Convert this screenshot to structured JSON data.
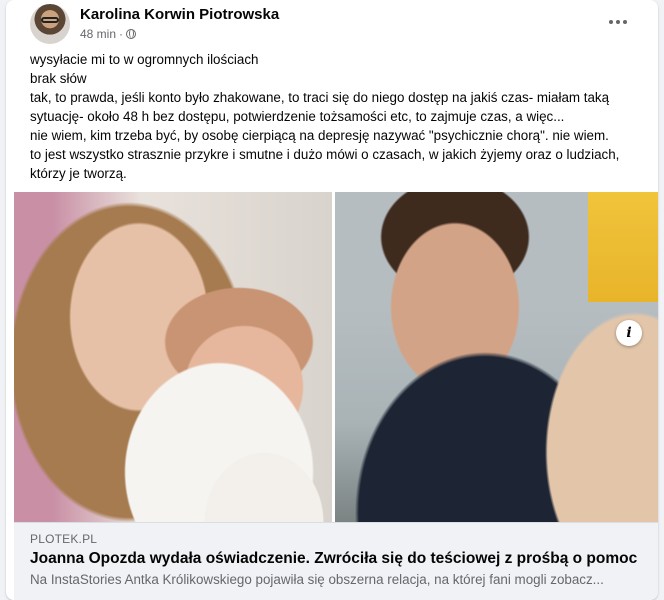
{
  "post": {
    "author": "Karolina Korwin Piotrowska",
    "time": "48 min",
    "separator": "·",
    "lines": [
      "wysyłacie mi to w ogromnych ilościach",
      "brak słów",
      "tak, to prawda, jeśli konto było zhakowane, to traci się do niego dostęp na jakiś czas- miałam taką sytuację- około 48 h bez dostępu, potwierdzenie tożsamości etc, to zajmuje czas, a więc...",
      "nie wiem, kim trzeba być, by osobę cierpiącą na depresję nazywać \"psychicznie chorą\". nie wiem.",
      "to jest wszystko strasznie przykre i smutne i dużo mówi o czasach, w jakich żyjemy oraz o ludziach, którzy je tworzą."
    ],
    "icons": {
      "privacy": "globe-icon",
      "more": "more-options-icon",
      "info": "info-icon"
    }
  },
  "link": {
    "source": "PLOTEK.PL",
    "title": "Joanna Opozda wydała oświadczenie. Zwróciła się do teściowej z prośbą o pomoc",
    "description": "Na InstaStories Antka Królikowskiego pojawiła się obszerna relacja, na której fani mogli zobacz...",
    "info_glyph": "i"
  }
}
